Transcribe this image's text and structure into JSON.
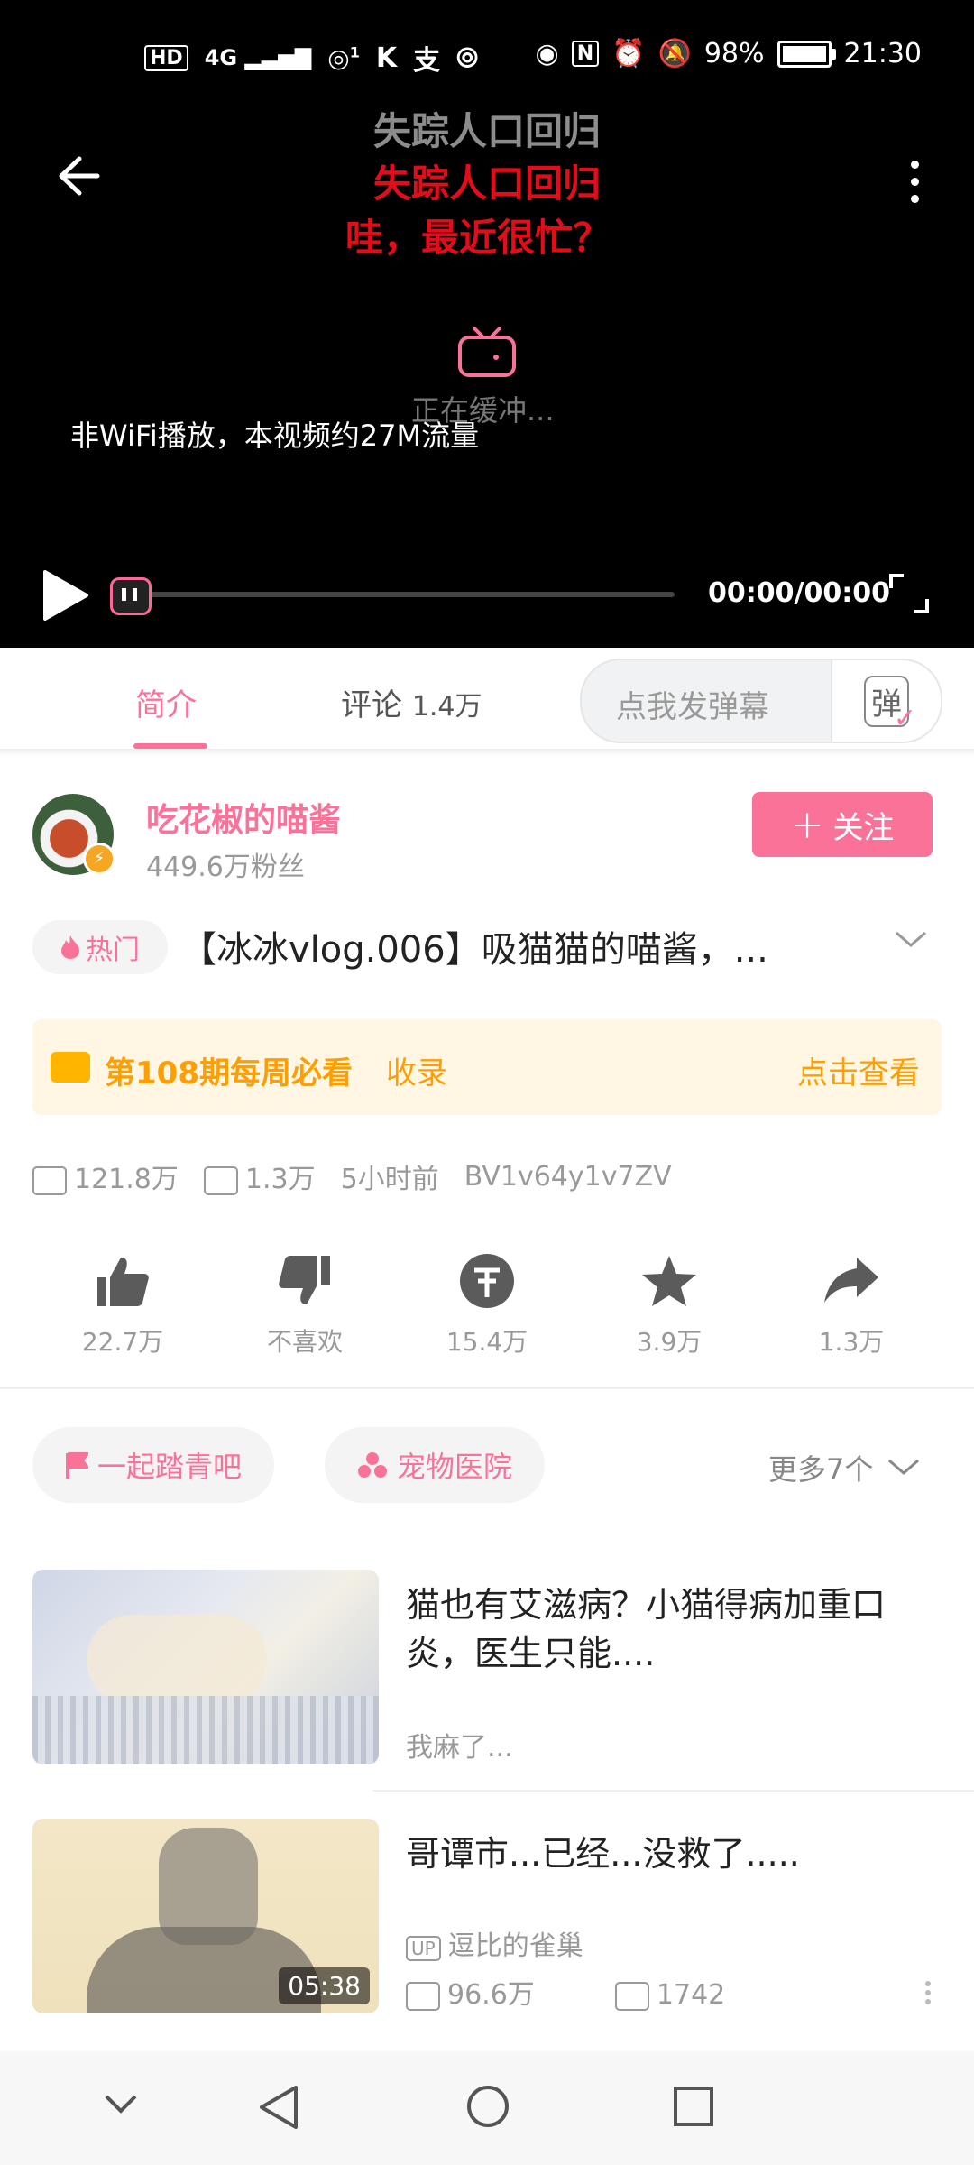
{
  "status_bar": {
    "left_icons": [
      "HD",
      "4G",
      "1"
    ],
    "battery": "98%",
    "time": "21:30"
  },
  "video": {
    "danmaku": [
      "失踪人口回归",
      "失踪人口回归",
      "哇，最近很忙？"
    ],
    "buffering_text": "正在缓冲...",
    "wifi_note": "非WiFi播放，本视频约27M流量",
    "time_display": "00:00/00:00"
  },
  "tabs": {
    "intro": "简介",
    "comments_label": "评论",
    "comments_count": "1.4万",
    "danmaku_placeholder": "点我发弹幕",
    "danmaku_btn": "弹"
  },
  "uploader": {
    "name": "吃花椒的喵酱",
    "fans": "449.6万粉丝",
    "follow": "关注"
  },
  "video_info": {
    "hot_label": "热门",
    "title": "【冰冰vlog.006】吸猫猫的喵酱，...",
    "weekly_title": "第108期每周必看",
    "weekly_suffix": "收录",
    "weekly_action": "点击查看",
    "views": "121.8万",
    "danmaku_count": "1.3万",
    "posted": "5小时前",
    "bvid": "BV1v64y1v7ZV"
  },
  "actions": [
    {
      "icon": "thumbs-up-icon",
      "label": "22.7万"
    },
    {
      "icon": "thumbs-down-icon",
      "label": "不喜欢"
    },
    {
      "icon": "coin-icon",
      "label": "15.4万"
    },
    {
      "icon": "star-icon",
      "label": "3.9万"
    },
    {
      "icon": "share-icon",
      "label": "1.3万"
    }
  ],
  "tags": [
    "一起踏青吧",
    "宠物医院"
  ],
  "more_tags": "更多7个",
  "recommendations": [
    {
      "title": "猫也有艾滋病？小猫得病加重口炎，医生只能....",
      "subtitle": "我麻了..."
    },
    {
      "title": "哥谭市...已经...没救了.....",
      "uploader": "逗比的雀巢",
      "views": "96.6万",
      "danmaku": "1742",
      "duration": "05:38"
    }
  ],
  "colors": {
    "accent": "#fb7299",
    "weekly": "#ff9e00",
    "danmu_red": "#e20c1a"
  }
}
